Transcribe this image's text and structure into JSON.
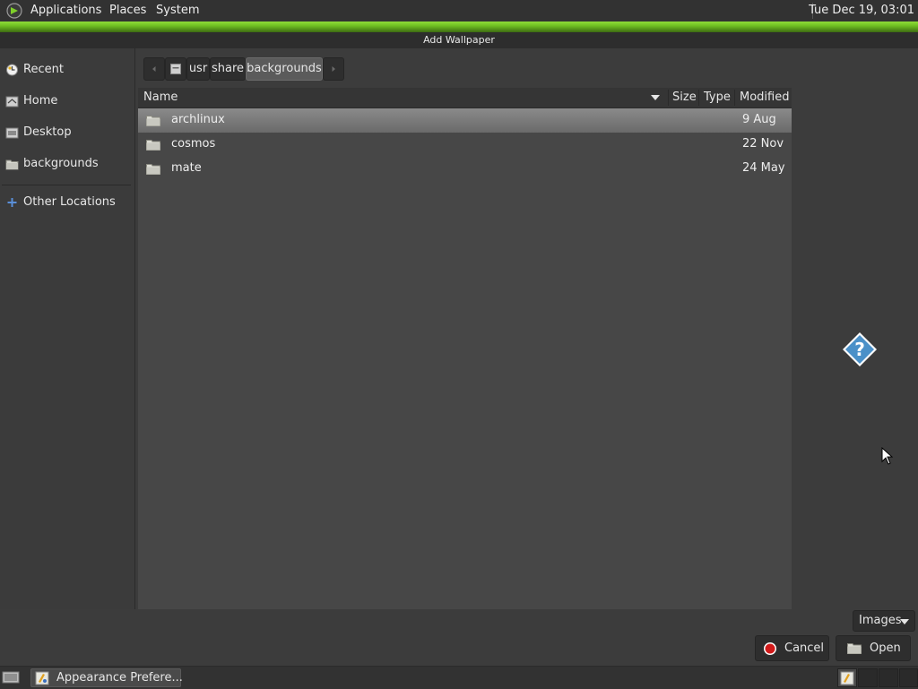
{
  "top_panel": {
    "menus": [
      "Applications",
      "Places",
      "System"
    ],
    "clock": "Tue Dec 19, 03:01"
  },
  "dialog": {
    "title": "Add Wallpaper"
  },
  "sidebar": {
    "items": [
      {
        "label": "Recent",
        "icon": "recent-icon"
      },
      {
        "label": "Home",
        "icon": "home-icon"
      },
      {
        "label": "Desktop",
        "icon": "desktop-icon"
      },
      {
        "label": "backgrounds",
        "icon": "folder-icon"
      },
      {
        "label": "Other Locations",
        "icon": "plus-icon"
      }
    ]
  },
  "pathbar": {
    "crumbs": [
      "usr",
      "share",
      "backgrounds"
    ]
  },
  "filelist": {
    "columns": [
      "Name",
      "Size",
      "Type",
      "Modified"
    ],
    "rows": [
      {
        "name": "archlinux",
        "modified": "9 Aug",
        "selected": true
      },
      {
        "name": "cosmos",
        "modified": "22 Nov",
        "selected": false
      },
      {
        "name": "mate",
        "modified": "24 May",
        "selected": false
      }
    ]
  },
  "filter": {
    "selected": "Images"
  },
  "buttons": {
    "cancel": "Cancel",
    "open": "Open"
  },
  "taskbar": {
    "window_label": "Appearance Prefere..."
  },
  "colors": {
    "accent": "#6fbf22",
    "selection": "#7a7a7a",
    "cancel_icon": "#d11a1a",
    "help_icon": "#4a90c8"
  }
}
